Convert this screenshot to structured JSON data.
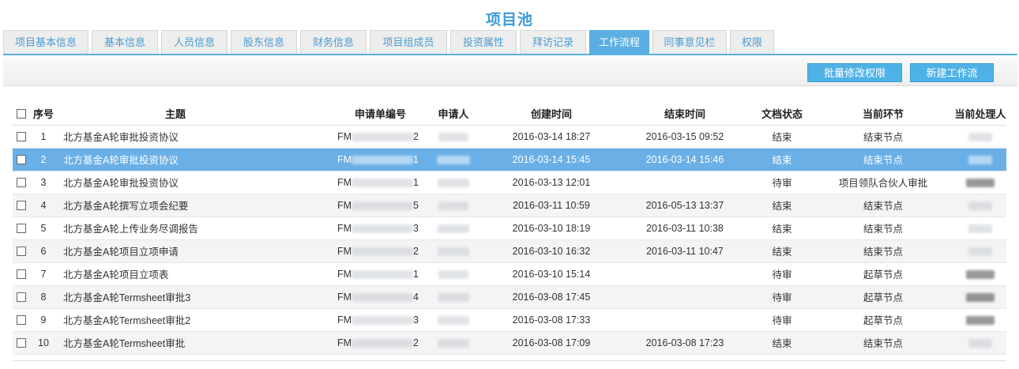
{
  "page_title": "项目池",
  "tabs": [
    "项目基本信息",
    "基本信息",
    "人员信息",
    "股东信息",
    "财务信息",
    "项目组成员",
    "投资属性",
    "拜访记录",
    "工作流程",
    "同事意见栏",
    "权限"
  ],
  "active_tab": "工作流程",
  "toolbar": {
    "batch_permission_label": "批量修改权限",
    "new_workflow_label": "新建工作流"
  },
  "table": {
    "headers": {
      "seq": "序号",
      "subject": "主题",
      "form_no": "申请单编号",
      "applicant": "申请人",
      "created": "创建时间",
      "ended": "结束时间",
      "doc_status": "文档状态",
      "current_step": "当前环节",
      "handler": "当前处理人"
    },
    "rows": [
      {
        "seq": "1",
        "subject": "北方基金A轮审批投资协议",
        "form_prefix": "FM",
        "form_suffix": "2",
        "created": "2016-03-14 18:27",
        "ended": "2016-03-15 09:52",
        "doc_status": "结束",
        "current_step": "结束节点"
      },
      {
        "seq": "2",
        "subject": "北方基金A轮审批投资协议",
        "form_prefix": "FM",
        "form_suffix": "1",
        "created": "2016-03-14 15:45",
        "ended": "2016-03-14 15:46",
        "doc_status": "结束",
        "current_step": "结束节点"
      },
      {
        "seq": "3",
        "subject": "北方基金A轮审批投资协议",
        "form_prefix": "FM",
        "form_suffix": "1",
        "created": "2016-03-13 12:01",
        "ended": "",
        "doc_status": "待审",
        "current_step": "项目领队合伙人审批"
      },
      {
        "seq": "4",
        "subject": "北方基金A轮撰写立项会纪要",
        "form_prefix": "FM",
        "form_suffix": "5",
        "created": "2016-03-11 10:59",
        "ended": "2016-05-13 13:37",
        "doc_status": "结束",
        "current_step": "结束节点"
      },
      {
        "seq": "5",
        "subject": "北方基金A轮上传业务尽调报告",
        "form_prefix": "FM",
        "form_suffix": "3",
        "created": "2016-03-10 18:19",
        "ended": "2016-03-11 10:38",
        "doc_status": "结束",
        "current_step": "结束节点"
      },
      {
        "seq": "6",
        "subject": "北方基金A轮项目立项申请",
        "form_prefix": "FM",
        "form_suffix": "2",
        "created": "2016-03-10 16:32",
        "ended": "2016-03-11 10:47",
        "doc_status": "结束",
        "current_step": "结束节点"
      },
      {
        "seq": "7",
        "subject": "北方基金A轮项目立项表",
        "form_prefix": "FM",
        "form_suffix": "1",
        "created": "2016-03-10 15:14",
        "ended": "",
        "doc_status": "待审",
        "current_step": "起草节点"
      },
      {
        "seq": "8",
        "subject": "北方基金A轮Termsheet审批3",
        "form_prefix": "FM",
        "form_suffix": "4",
        "created": "2016-03-08 17:45",
        "ended": "",
        "doc_status": "待审",
        "current_step": "起草节点"
      },
      {
        "seq": "9",
        "subject": "北方基金A轮Termsheet审批2",
        "form_prefix": "FM",
        "form_suffix": "3",
        "created": "2016-03-08 17:33",
        "ended": "",
        "doc_status": "待审",
        "current_step": "起草节点"
      },
      {
        "seq": "10",
        "subject": "北方基金A轮Termsheet审批",
        "form_prefix": "FM",
        "form_suffix": "2",
        "created": "2016-03-08 17:09",
        "ended": "2016-03-08 17:23",
        "doc_status": "结束",
        "current_step": "结束节点"
      }
    ]
  },
  "selected_row": "2",
  "colors": {
    "accent": "#5aaee2",
    "button": "#4fb2e6",
    "selected_row": "#6aafe6",
    "title": "#3a9ad9"
  }
}
